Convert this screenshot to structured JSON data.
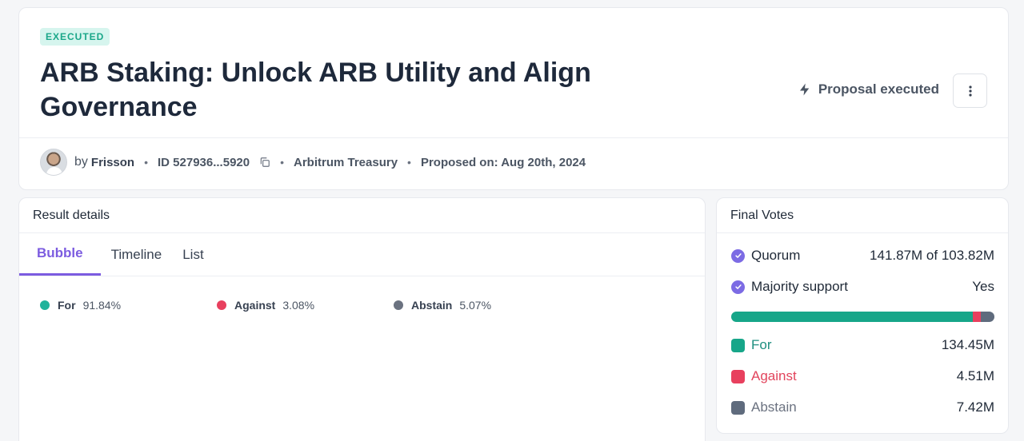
{
  "proposal": {
    "badge": "EXECUTED",
    "title": "ARB Staking: Unlock ARB Utility and Align Governance",
    "status": "Proposal executed",
    "author_prefix": "by",
    "author": "Frisson",
    "id": "ID 527936...5920",
    "organization": "Arbitrum Treasury",
    "proposed_on": "Proposed on: Aug 20th, 2024"
  },
  "result": {
    "header": "Result details",
    "tabs": [
      "Bubble",
      "Timeline",
      "List"
    ],
    "active_tab": "Bubble",
    "legend": [
      {
        "name": "For",
        "pct": "91.84%",
        "color": "#20b39b"
      },
      {
        "name": "Against",
        "pct": "3.08%",
        "color": "#e8405e"
      },
      {
        "name": "Abstain",
        "pct": "5.07%",
        "color": "#6b7280"
      }
    ]
  },
  "final_votes": {
    "header": "Final Votes",
    "quorum": {
      "label": "Quorum",
      "value": "141.87M of 103.82M"
    },
    "majority": {
      "label": "Majority support",
      "value": "Yes"
    },
    "bar": {
      "for": 91.84,
      "against": 3.08,
      "abstain": 5.07
    },
    "rows": [
      {
        "name": "For",
        "value": "134.45M",
        "color": "#17a689"
      },
      {
        "name": "Against",
        "value": "4.51M",
        "color": "#e8405e"
      },
      {
        "name": "Abstain",
        "value": "7.42M",
        "color": "#5f6b7d"
      }
    ]
  },
  "colors": {
    "accent": "#7c5ce0",
    "executed_bg": "#d6f5ee",
    "executed_text": "#1aa789"
  },
  "icons": [
    "lightning-icon",
    "more-vertical-icon",
    "copy-icon",
    "check-circle-icon"
  ]
}
